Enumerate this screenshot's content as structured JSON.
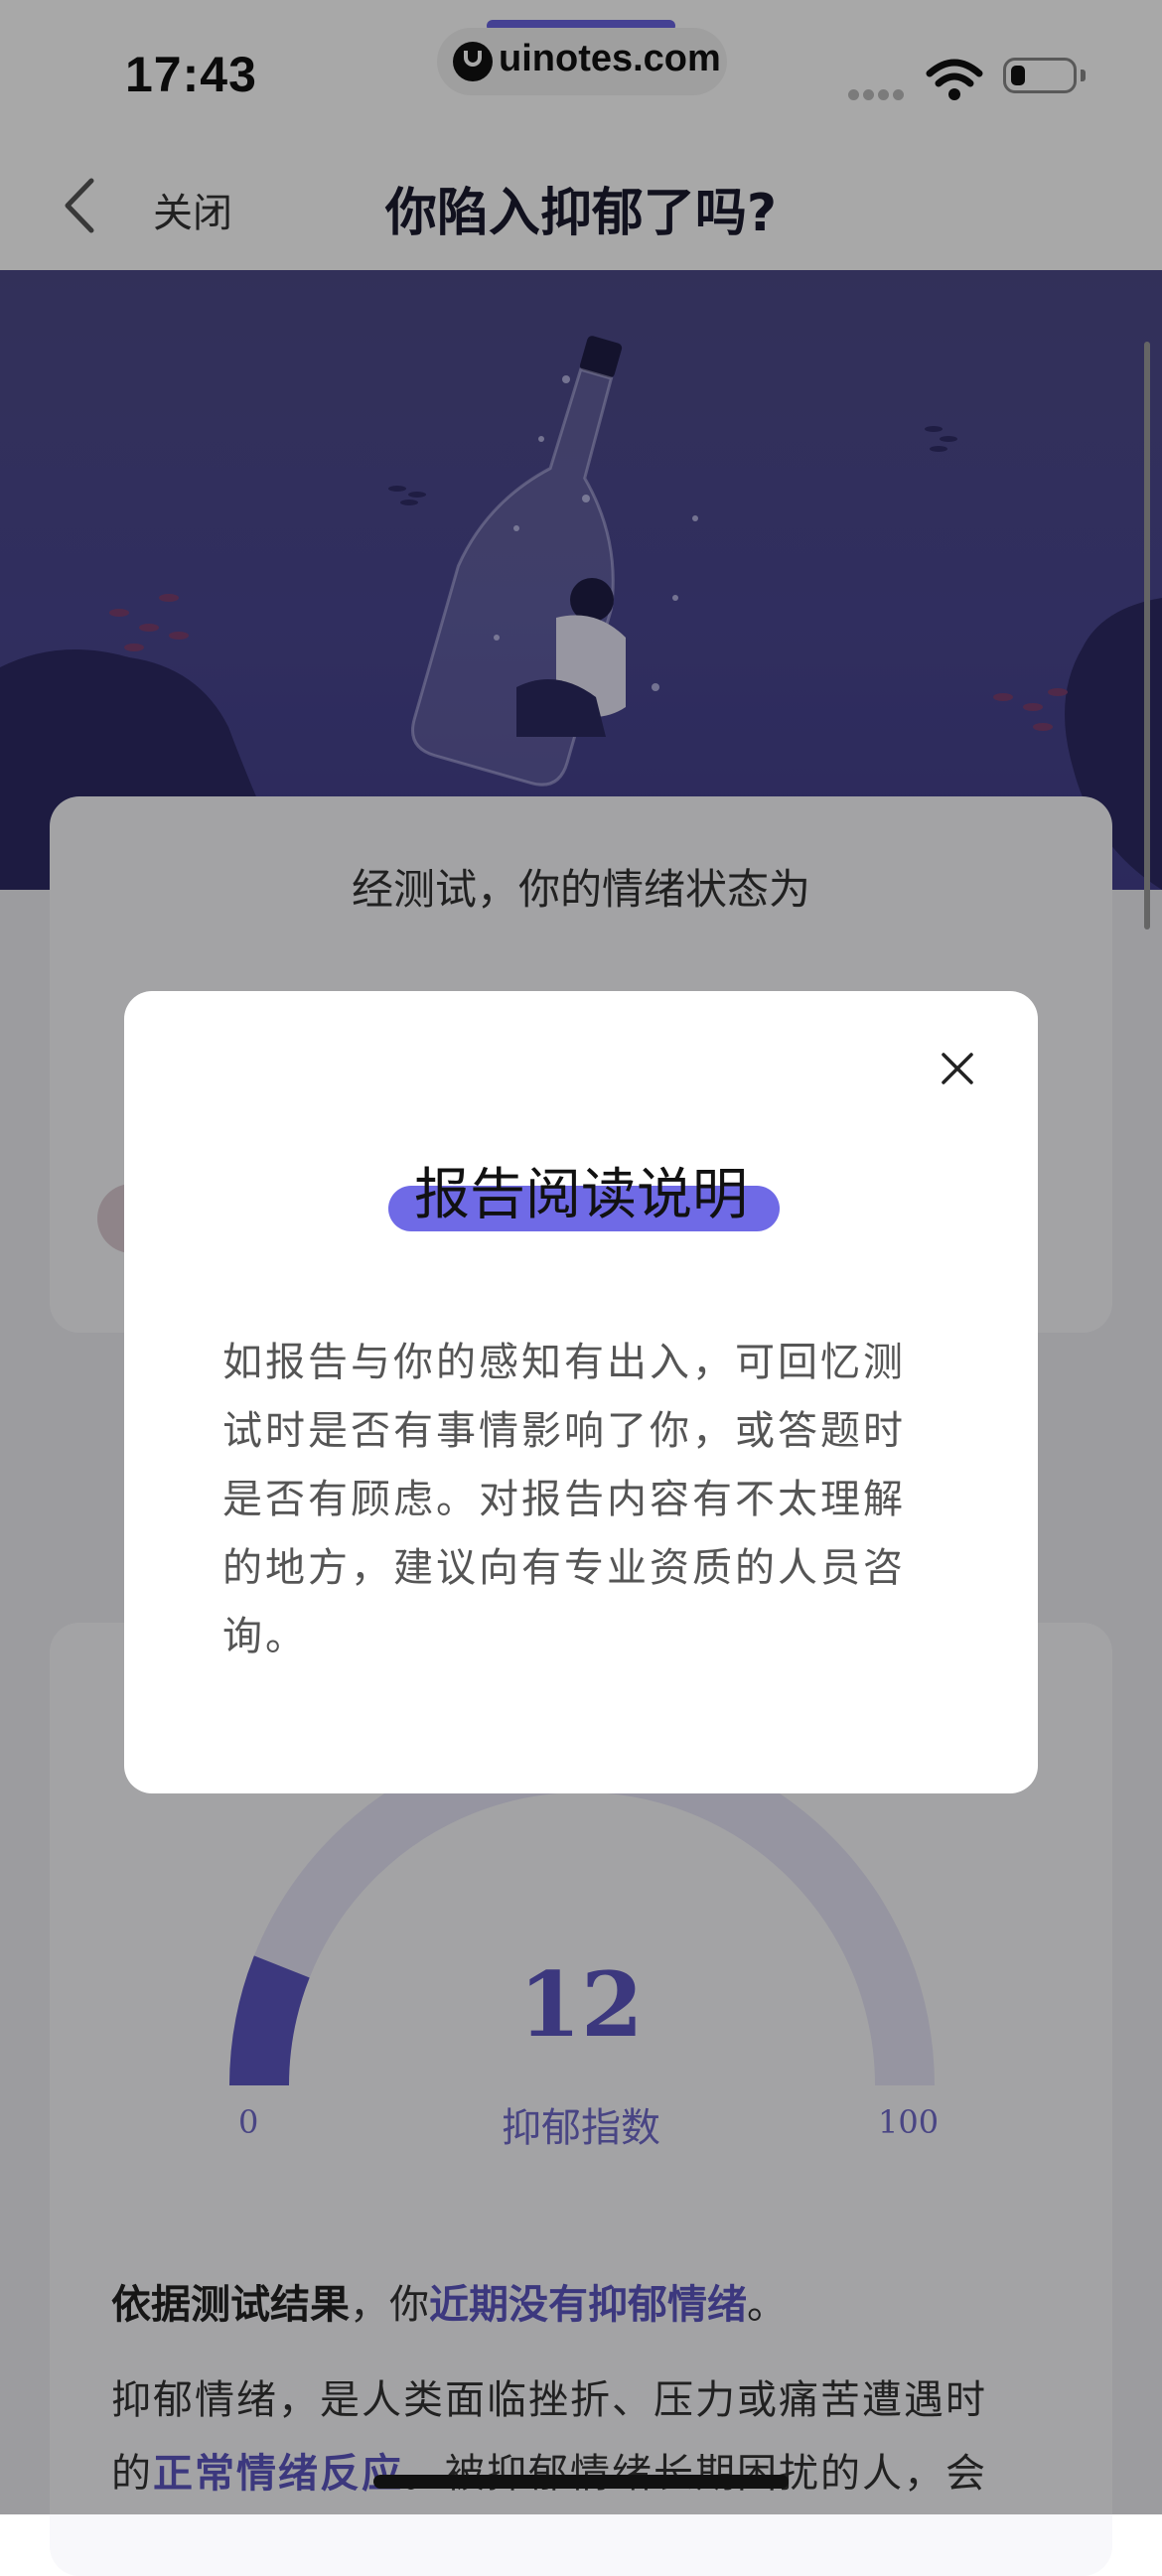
{
  "status_bar": {
    "time": "17:43",
    "url": "uinotes.com"
  },
  "nav": {
    "close_label": "关闭",
    "title": "你陷入抑郁了吗?"
  },
  "result_card": {
    "heading": "经测试，你的情绪状态为"
  },
  "gauge": {
    "value": "12",
    "label": "抑郁指数",
    "min_label": "0",
    "max_label": "100",
    "min": 0,
    "max": 100,
    "level": 12,
    "fill_color": "#5b55c0",
    "track_color": "#e4e2f4"
  },
  "result_text": {
    "prefix": "依据测试结果",
    "middle": "，你",
    "highlight": "近期没有抑郁情绪",
    "suffix": "。"
  },
  "description": {
    "line1": "抑郁情绪，是人类面临挫折、压力或痛苦遭遇时",
    "line2_prefix": "的",
    "line2_highlight": "正常情绪反应",
    "line2_suffix": "。被抑郁情绪长期困扰的人，会"
  },
  "modal": {
    "title": "报告阅读说明",
    "body": "如报告与你的感知有出入，可回忆测试时是否有事情影响了你，或答题时是否有顾虑。对报告内容有不太理解的地方，建议向有专业资质的人员咨询。"
  },
  "icons": {
    "back": "chevron-left-icon",
    "close": "close-icon",
    "wifi": "wifi-icon",
    "battery": "battery-icon"
  },
  "colors": {
    "accent": "#6f6ae6",
    "hero": "#4a4790"
  }
}
